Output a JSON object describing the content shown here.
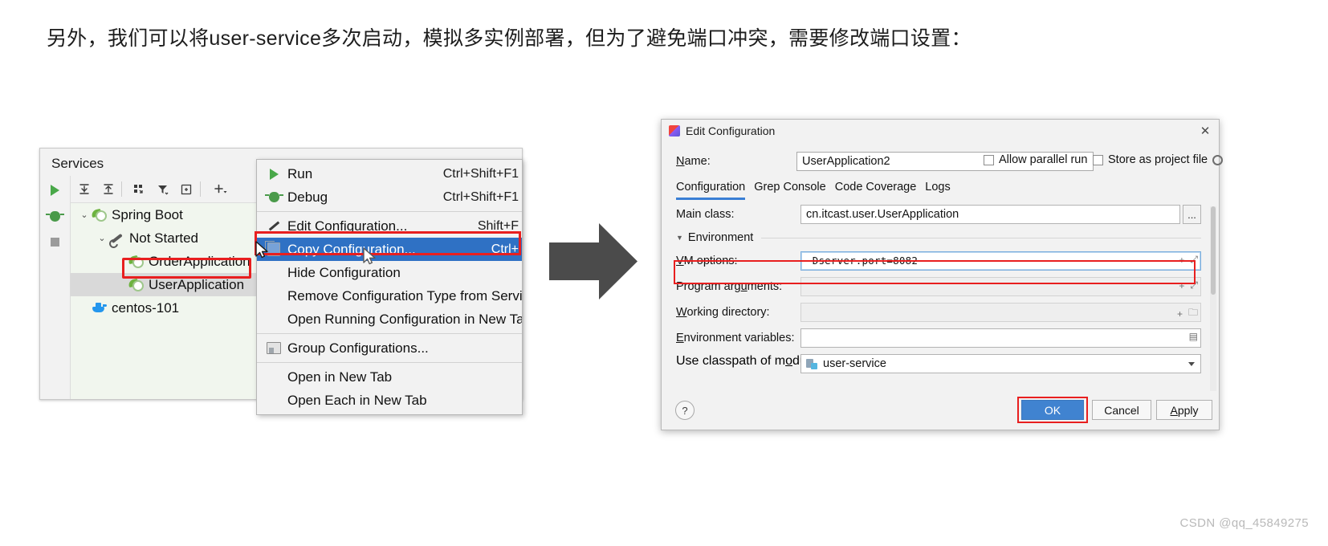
{
  "caption": "另外，我们可以将user-service多次启动，模拟多实例部署，但为了避免端口冲突，需要修改端口设置：",
  "services": {
    "title": "Services",
    "toolbar_vertical": [
      {
        "name": "run-icon",
        "glyph": ""
      },
      {
        "name": "debug-icon",
        "glyph": ""
      },
      {
        "name": "stop-icon",
        "glyph": ""
      }
    ],
    "toolbar_horizontal": [
      {
        "name": "expand-all-icon",
        "glyph": "⤒"
      },
      {
        "name": "collapse-all-icon",
        "glyph": "⤓"
      },
      {
        "name": "group-by-icon",
        "glyph": "⠿"
      },
      {
        "name": "filter-icon",
        "glyph": "▼"
      },
      {
        "name": "add-tab-icon",
        "glyph": "⊞"
      },
      {
        "name": "add-icon",
        "glyph": "+"
      }
    ],
    "tree": [
      {
        "label": "Spring Boot",
        "icon": "spring-boot-icon",
        "chevron": "⌄",
        "indent": 1,
        "selected": false
      },
      {
        "label": "Not Started",
        "icon": "wrench-icon",
        "chevron": "⌄",
        "indent": 2,
        "selected": false
      },
      {
        "label": "OrderApplication",
        "icon": "spring-boot-icon",
        "chevron": "",
        "indent": 3,
        "selected": false
      },
      {
        "label": "UserApplication",
        "icon": "spring-boot-icon",
        "chevron": "",
        "indent": 3,
        "selected": true
      },
      {
        "label": "centos-101",
        "icon": "docker-icon",
        "chevron": "",
        "indent": 0,
        "selected": false
      }
    ]
  },
  "context_menu": {
    "items": [
      {
        "label": "Run",
        "shortcut": "Ctrl+Shift+F1",
        "icon": "run-icon",
        "highlight": false,
        "separator_after": false
      },
      {
        "label": "Debug",
        "shortcut": "Ctrl+Shift+F1",
        "icon": "debug-icon",
        "highlight": false,
        "separator_after": true
      },
      {
        "label": "Edit Configuration...",
        "shortcut": "Shift+F",
        "icon": "pencil-icon",
        "highlight": false,
        "separator_after": false
      },
      {
        "label": "Copy Configuration...",
        "shortcut": "Ctrl+",
        "icon": "copy-icon",
        "highlight": true,
        "separator_after": false
      },
      {
        "label": "Hide Configuration",
        "shortcut": "",
        "icon": "",
        "highlight": false,
        "separator_after": false
      },
      {
        "label": "Remove Configuration Type from Services",
        "shortcut": "",
        "icon": "",
        "highlight": false,
        "separator_after": false
      },
      {
        "label": "Open Running Configuration in New Tab",
        "shortcut": "",
        "icon": "",
        "highlight": false,
        "separator_after": true
      },
      {
        "label": "Group Configurations...",
        "shortcut": "",
        "icon": "folder-icon",
        "highlight": false,
        "separator_after": true
      },
      {
        "label": "Open in New Tab",
        "shortcut": "",
        "icon": "",
        "highlight": false,
        "separator_after": false
      },
      {
        "label": "Open Each in New Tab",
        "shortcut": "",
        "icon": "",
        "highlight": false,
        "separator_after": false
      }
    ]
  },
  "dialog": {
    "title": "Edit Configuration",
    "close_glyph": "✕",
    "name_label": "Name:",
    "name_value": "UserApplication2",
    "allow_parallel_run": "Allow parallel run",
    "store_as_project_file": "Store as project file",
    "tabs": [
      {
        "label": "Configuration",
        "active": true
      },
      {
        "label": "Grep Console",
        "active": false
      },
      {
        "label": "Code Coverage",
        "active": false
      },
      {
        "label": "Logs",
        "active": false
      }
    ],
    "main_class_label": "Main class:",
    "main_class_value": "cn.itcast.user.UserApplication",
    "main_class_browse": "...",
    "environment_label": "Environment",
    "environment_caret": "▼",
    "fields": [
      {
        "label": "VM options:",
        "value": "-Dserver.port=8082",
        "trailing": [
          "+",
          "⤢"
        ],
        "focused": true,
        "mono": true
      },
      {
        "label": "Program arguments:",
        "value": "",
        "trailing": [
          "+",
          "⤢"
        ],
        "focused": false,
        "mono": false
      },
      {
        "label": "Working directory:",
        "value": "",
        "trailing": [
          "+",
          "🗀"
        ],
        "focused": false,
        "mono": false
      },
      {
        "label": "Environment variables:",
        "value": "",
        "trailing": [
          "▤"
        ],
        "focused": false,
        "mono": false
      }
    ],
    "classpath_label": "Use classpath of module:",
    "classpath_value": "user-service",
    "help_glyph": "?",
    "buttons": [
      {
        "label": "OK",
        "primary": true
      },
      {
        "label": "Cancel",
        "primary": false
      },
      {
        "label": "Apply",
        "primary": false
      }
    ]
  },
  "watermark": "CSDN @qq_45849275",
  "colors": {
    "highlight_blue": "#2f71c4",
    "accent_red": "#e81f1f",
    "primary_button": "#4083d0",
    "spring_green": "#6db33f",
    "docker_blue": "#2496ed"
  }
}
